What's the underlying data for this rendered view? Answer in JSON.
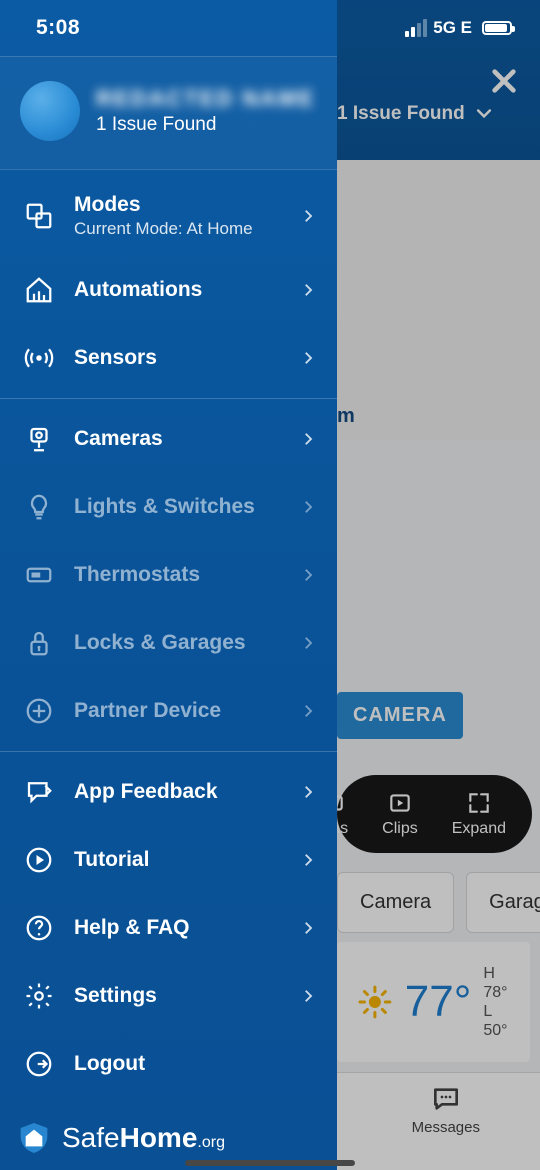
{
  "status": {
    "time": "5:08",
    "network": "5G E"
  },
  "bg": {
    "issue_badge": "1 Issue Found",
    "warm": "m",
    "camera_btn": "CAMERA",
    "pill": {
      "cameras": "eras",
      "clips": "Clips",
      "expand": "Expand"
    },
    "chips": {
      "camera": "Camera",
      "garage": "Garage"
    },
    "weather": {
      "temp": "77°",
      "hi": "H 78°",
      "lo": "L 50°"
    },
    "messages": "Messages"
  },
  "profile": {
    "name_hidden": "REDACTED NAME",
    "issue": "1 Issue Found"
  },
  "menu": {
    "modes": {
      "label": "Modes",
      "sub": "Current Mode: At Home"
    },
    "automations": "Automations",
    "sensors": "Sensors",
    "cameras": "Cameras",
    "lights": "Lights & Switches",
    "thermostats": "Thermostats",
    "locks": "Locks & Garages",
    "partner": "Partner Device",
    "feedback": "App Feedback",
    "tutorial": "Tutorial",
    "help": "Help & FAQ",
    "settings": "Settings",
    "logout": "Logout"
  },
  "brand": {
    "prefix": "Safe",
    "mid": "Home",
    "suffix": ".org"
  }
}
